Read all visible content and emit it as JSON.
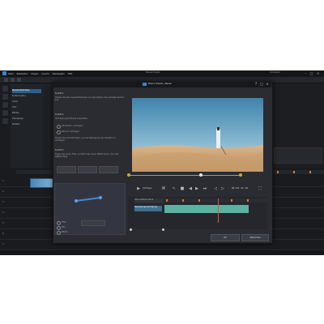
{
  "app": {
    "title": "Motion Tracker | Neues",
    "menu": [
      "Datei",
      "Bearbeiten",
      "Plugins",
      "Ansicht",
      "Wiedergabe",
      "Hilfe"
    ],
    "user": "Anmelden",
    "window_title": "Neues Projekt"
  },
  "library": {
    "items": [
      "Medienbibliothek",
      "Farbkorrektur",
      "Audio",
      "Titel",
      "Effekte",
      "Übergänge",
      "Partikel"
    ]
  },
  "dialog": {
    "title": "Motion Tracker | Neues",
    "step1": {
      "heading": "Schritt 1",
      "text": "Ziehen Sie den Auswahlrahmen um das Objekt, das verfolgt werden soll."
    },
    "step2": {
      "heading": "Schritt 2",
      "text": "Verfolgungsmethode auswählen",
      "option1": "Ab Position verfolgen",
      "option2": "Bereich verfolgen"
    },
    "step2b_text": "Klicken Sie auf Verfolgen, um die Bewegung des Objekts zu verfolgen.",
    "step3": {
      "heading": "Schritt 3",
      "text": "Fügen Sie einen Titel, ein Bild oder einen Effekt hinzu, der dem Objekt folgt."
    },
    "preview_labels": [
      "Titel",
      "Bild",
      "Effekt"
    ],
    "track_button": "Verfolgen",
    "timecode": "00 ; 00 ; 12 ; 10",
    "track_tab": "Ohne Motion-Track",
    "track_clip": "Bewegungsverfolgung",
    "ok": "OK",
    "cancel": "Abbrechen"
  },
  "timeline": {
    "tracks": [
      "1.",
      "2.",
      "3.",
      "4.",
      "5.",
      "6.",
      "7."
    ]
  },
  "colors": {
    "accent": "#3c82c8",
    "track_clip": "#5fb0a0",
    "playhead": "#e05050",
    "scrub_knob": "#d9a433"
  },
  "icons": [
    "play-icon",
    "pause-icon",
    "stop-icon",
    "prev-frame-icon",
    "next-frame-icon",
    "fullscreen-icon",
    "close-icon",
    "minimize-icon",
    "maximize-icon"
  ]
}
